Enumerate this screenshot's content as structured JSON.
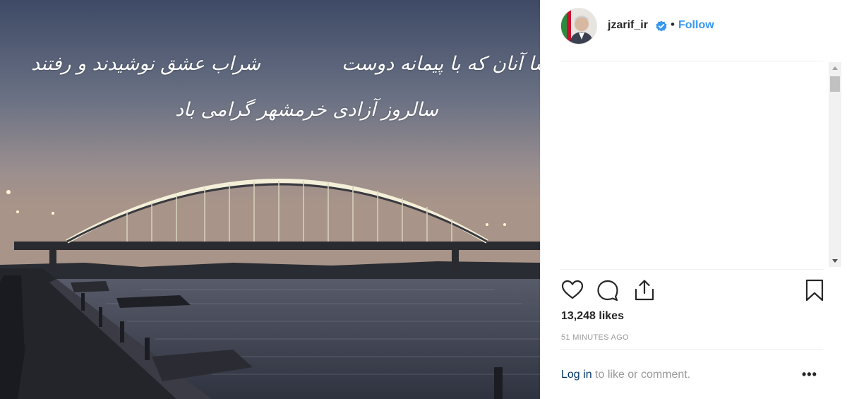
{
  "photo": {
    "text_line1_right": "خوشا آنان که با پیمانه دوست",
    "text_line1_left": "شراب عشق نوشیدند و رفتند",
    "text_line2": "سالروز آزادی خرمشهر گرامی باد"
  },
  "header": {
    "username": "jzarif_ir",
    "separator": "•",
    "follow_label": "Follow"
  },
  "stats": {
    "likes": "13,248 likes",
    "time_ago": "51 MINUTES AGO"
  },
  "footer": {
    "login_link": "Log in",
    "login_suffix": " to like or comment.",
    "more_label": "•••"
  },
  "icons": {
    "like": "heart-icon",
    "comment": "comment-icon",
    "share": "share-icon",
    "save": "bookmark-icon",
    "verified": "verified-badge-icon"
  },
  "colors": {
    "link_blue": "#3897f0",
    "login_blue": "#003569",
    "verified_blue": "#3897f0"
  }
}
